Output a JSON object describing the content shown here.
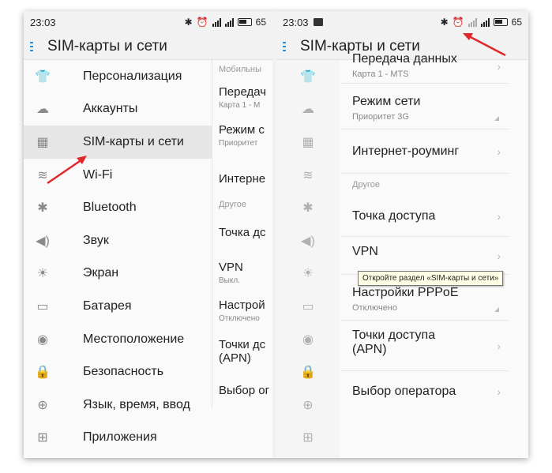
{
  "left_phone": {
    "status": {
      "time": "23:03",
      "battery": "65"
    },
    "title": "SIM-карты и сети",
    "settings_items": [
      {
        "label": "Персонализация",
        "icon": "shirt-icon"
      },
      {
        "label": "Аккаунты",
        "icon": "cloud-icon"
      },
      {
        "label": "SIM-карты и сети",
        "icon": "sim-card-icon"
      },
      {
        "label": "Wi-Fi",
        "icon": "wifi-icon"
      },
      {
        "label": "Bluetooth",
        "icon": "bluetooth-icon"
      },
      {
        "label": "Звук",
        "icon": "speaker-icon"
      },
      {
        "label": "Экран",
        "icon": "brightness-icon"
      },
      {
        "label": "Батарея",
        "icon": "battery-icon"
      },
      {
        "label": "Местоположение",
        "icon": "location-icon"
      },
      {
        "label": "Безопасность",
        "icon": "lock-icon"
      },
      {
        "label": "Язык, время, ввод",
        "icon": "globe-icon"
      },
      {
        "label": "Приложения",
        "icon": "apps-grid-icon"
      }
    ],
    "detail_pane": {
      "header_mobile": "Мобильны",
      "items": [
        {
          "title": "Передач",
          "subtitle": "Карта 1 - М"
        },
        {
          "title": "Режим с",
          "subtitle": "Приоритет"
        },
        {
          "title": "Интерне",
          "subtitle": ""
        }
      ],
      "header_other": "Другое",
      "items2": [
        {
          "title": "Точка дс",
          "subtitle": ""
        },
        {
          "title": "VPN",
          "subtitle": "Выкл."
        },
        {
          "title": "Настрой",
          "subtitle": "Отключено"
        },
        {
          "title": "Точки дс",
          "title2": "(APN)",
          "subtitle": ""
        },
        {
          "title": "Выбор ог",
          "subtitle": ""
        }
      ]
    }
  },
  "right_phone": {
    "status": {
      "time": "23:03",
      "battery": "65"
    },
    "title": "SIM-карты и сети",
    "partial_top": {
      "title": "Передача данных",
      "subtitle": "Карта 1 - MTS"
    },
    "items": [
      {
        "title": "Режим сети",
        "subtitle": "Приоритет 3G",
        "kind": "corner"
      },
      {
        "title": "Интернет-роуминг",
        "subtitle": "",
        "kind": "chevron"
      }
    ],
    "header_other": "Другое",
    "items2": [
      {
        "title": "Точка доступа",
        "subtitle": "",
        "kind": "chevron"
      },
      {
        "title": "VPN",
        "subtitle": "",
        "kind": "chevron"
      },
      {
        "title": "Настройки PPPoE",
        "subtitle": "Отключено",
        "kind": "corner"
      },
      {
        "title": "Точки доступа",
        "title2": "(APN)",
        "subtitle": "",
        "kind": "chevron"
      },
      {
        "title": "Выбор оператора",
        "subtitle": "",
        "kind": "chevron"
      }
    ]
  },
  "tooltip": "Откройте раздел «SIM-карты и сети»",
  "colors": {
    "accent": "#2b8fd6",
    "arrow": "#e0282a"
  }
}
